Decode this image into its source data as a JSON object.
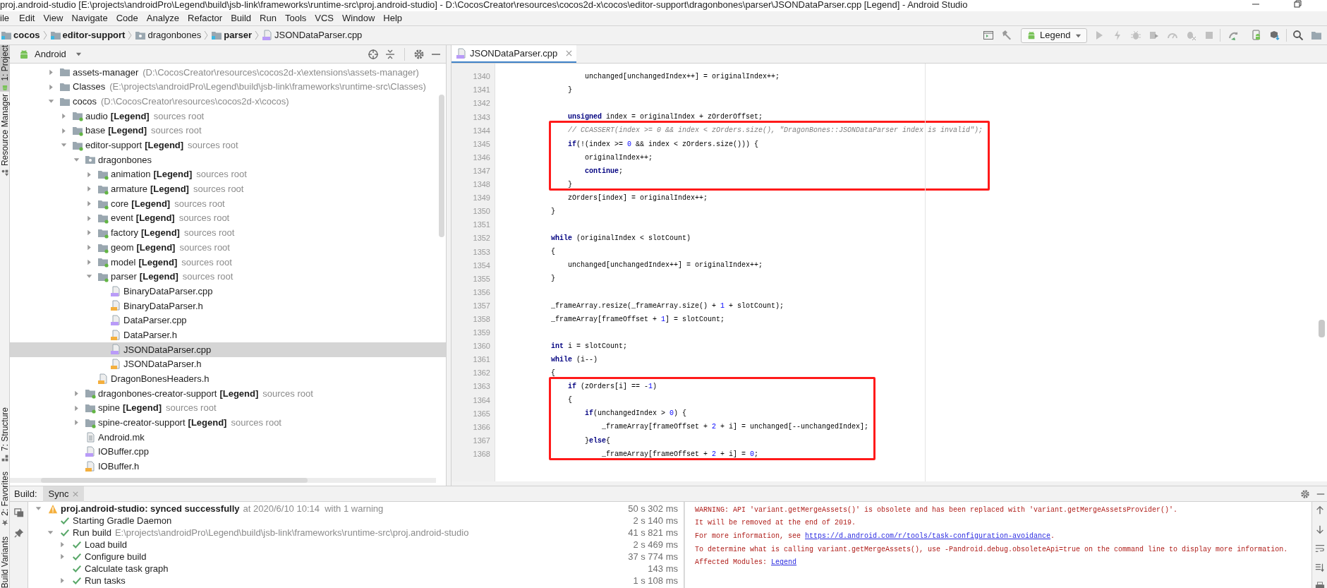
{
  "window": {
    "title": "proj.android-studio [E:\\projects\\androidPro\\Legend\\build\\jsb-link\\frameworks\\runtime-src\\proj.android-studio] - D:\\CocosCreator\\resources\\cocos2d-x\\cocos\\editor-support\\dragonbones\\parser\\JSONDataParser.cpp [Legend] - Android Studio"
  },
  "menu": [
    "ile",
    "Edit",
    "View",
    "Navigate",
    "Code",
    "Analyze",
    "Refactor",
    "Build",
    "Run",
    "Tools",
    "VCS",
    "Window",
    "Help"
  ],
  "breadcrumb": [
    {
      "label": "cocos",
      "kind": "module"
    },
    {
      "label": "editor-support",
      "kind": "module"
    },
    {
      "label": "dragonbones",
      "kind": "package"
    },
    {
      "label": "parser",
      "kind": "module"
    },
    {
      "label": "JSONDataParser.cpp",
      "kind": "cpp"
    }
  ],
  "toolbar": {
    "run_configuration": "Legend"
  },
  "tool_window_stripe": [
    {
      "label": "1: Project",
      "kind": "project",
      "selected": true
    },
    {
      "label": "Resource Manager",
      "kind": "resources",
      "selected": false
    },
    {
      "label": "7: Structure",
      "kind": "structure",
      "selected": false
    },
    {
      "label": "2: Favorites",
      "kind": "favorites",
      "selected": false
    },
    {
      "label": "Build Variants",
      "kind": "variants",
      "selected": false
    }
  ],
  "project_panel": {
    "view": "Android",
    "tree": [
      {
        "name": "assets-manager",
        "note": "(D:\\CocosCreator\\resources\\cocos2d-x\\extensions\\assets-manager)",
        "kind": "folder",
        "expanded": false,
        "selected": false
      },
      {
        "name": "Classes",
        "note": "(E:\\projects\\androidPro\\Legend\\build\\jsb-link\\frameworks\\runtime-src\\Classes)",
        "kind": "folder",
        "expanded": false,
        "selected": false
      },
      {
        "name": "cocos",
        "note": "(D:\\CocosCreator\\resources\\cocos2d-x\\cocos)",
        "kind": "folder",
        "expanded": true,
        "selected": false,
        "children": [
          {
            "name": "audio",
            "module": "[Legend]",
            "note": "sources root",
            "kind": "source",
            "expanded": false,
            "selected": false
          },
          {
            "name": "base",
            "module": "[Legend]",
            "note": "sources root",
            "kind": "source",
            "expanded": false,
            "selected": false
          },
          {
            "name": "editor-support",
            "module": "[Legend]",
            "note": "sources root",
            "kind": "source",
            "expanded": true,
            "selected": false,
            "children": [
              {
                "name": "dragonbones",
                "kind": "package",
                "expanded": true,
                "selected": false,
                "children": [
                  {
                    "name": "animation",
                    "module": "[Legend]",
                    "note": "sources root",
                    "kind": "source",
                    "expanded": false,
                    "selected": false
                  },
                  {
                    "name": "armature",
                    "module": "[Legend]",
                    "note": "sources root",
                    "kind": "source",
                    "expanded": false,
                    "selected": false
                  },
                  {
                    "name": "core",
                    "module": "[Legend]",
                    "note": "sources root",
                    "kind": "source",
                    "expanded": false,
                    "selected": false
                  },
                  {
                    "name": "event",
                    "module": "[Legend]",
                    "note": "sources root",
                    "kind": "source",
                    "expanded": false,
                    "selected": false
                  },
                  {
                    "name": "factory",
                    "module": "[Legend]",
                    "note": "sources root",
                    "kind": "source",
                    "expanded": false,
                    "selected": false
                  },
                  {
                    "name": "geom",
                    "module": "[Legend]",
                    "note": "sources root",
                    "kind": "source",
                    "expanded": false,
                    "selected": false
                  },
                  {
                    "name": "model",
                    "module": "[Legend]",
                    "note": "sources root",
                    "kind": "source",
                    "expanded": false,
                    "selected": false
                  },
                  {
                    "name": "parser",
                    "module": "[Legend]",
                    "note": "sources root",
                    "kind": "source",
                    "expanded": true,
                    "selected": false,
                    "children": [
                      {
                        "name": "BinaryDataParser.cpp",
                        "kind": "cpp",
                        "selected": false
                      },
                      {
                        "name": "BinaryDataParser.h",
                        "kind": "h",
                        "selected": false
                      },
                      {
                        "name": "DataParser.cpp",
                        "kind": "cpp",
                        "selected": false
                      },
                      {
                        "name": "DataParser.h",
                        "kind": "h",
                        "selected": false
                      },
                      {
                        "name": "JSONDataParser.cpp",
                        "kind": "cpp",
                        "selected": true
                      },
                      {
                        "name": "JSONDataParser.h",
                        "kind": "h",
                        "selected": false
                      }
                    ]
                  },
                  {
                    "name": "DragonBonesHeaders.h",
                    "kind": "h",
                    "selected": false
                  }
                ]
              },
              {
                "name": "dragonbones-creator-support",
                "module": "[Legend]",
                "note": "sources root",
                "kind": "source",
                "expanded": false,
                "selected": false
              },
              {
                "name": "spine",
                "module": "[Legend]",
                "note": "sources root",
                "kind": "source",
                "expanded": false,
                "selected": false
              },
              {
                "name": "spine-creator-support",
                "module": "[Legend]",
                "note": "sources root",
                "kind": "source",
                "expanded": false,
                "selected": false
              },
              {
                "name": "Android.mk",
                "kind": "mk",
                "selected": false
              },
              {
                "name": "IOBuffer.cpp",
                "kind": "cpp",
                "selected": false
              },
              {
                "name": "IOBuffer.h",
                "kind": "h",
                "selected": false
              }
            ]
          }
        ]
      }
    ]
  },
  "editor": {
    "tabs": [
      {
        "label": "JSONDataParser.cpp",
        "selected": true
      }
    ],
    "lines": [
      {
        "number": "1340",
        "boxed": false,
        "tokens": [
          {
            "text": "                unchanged[unchangedIndex++] = originalIndex++;",
            "kind": "plain"
          }
        ]
      },
      {
        "number": "1341",
        "boxed": false,
        "tokens": [
          {
            "text": "            }",
            "kind": "plain"
          }
        ]
      },
      {
        "number": "1342",
        "boxed": false
      },
      {
        "number": "1343",
        "boxed": false,
        "tokens": [
          {
            "text": "            unsigned",
            "kind": "keyword"
          },
          {
            "text": " index = originalIndex + zOrderOffset;",
            "kind": "plain"
          }
        ]
      },
      {
        "number": "1344",
        "boxed": true,
        "tokens": [
          {
            "text": "            // CCASSERT(index >= 0 && index < zOrders.size(), \"DragonBones::JSONDataParser index is invalid\");",
            "kind": "comment"
          }
        ]
      },
      {
        "number": "1345",
        "boxed": true,
        "tokens": [
          {
            "text": "            if",
            "kind": "keyword"
          },
          {
            "text": "(!(index >= ",
            "kind": "plain"
          },
          {
            "text": "0",
            "kind": "number"
          },
          {
            "text": " && index < zOrders.size())) {",
            "kind": "plain"
          }
        ]
      },
      {
        "number": "1346",
        "boxed": true,
        "tokens": [
          {
            "text": "                originalIndex++;",
            "kind": "plain"
          }
        ]
      },
      {
        "number": "1347",
        "boxed": true,
        "tokens": [
          {
            "text": "                continue",
            "kind": "keyword"
          },
          {
            "text": ";",
            "kind": "plain"
          }
        ]
      },
      {
        "number": "1348",
        "boxed": true,
        "tokens": [
          {
            "text": "            }",
            "kind": "plain"
          }
        ]
      },
      {
        "number": "1349",
        "boxed": false,
        "tokens": [
          {
            "text": "            zOrders[index] = originalIndex++;",
            "kind": "plain"
          }
        ]
      },
      {
        "number": "1350",
        "boxed": false,
        "tokens": [
          {
            "text": "        }",
            "kind": "plain"
          }
        ]
      },
      {
        "number": "1351",
        "boxed": false
      },
      {
        "number": "1352",
        "boxed": false,
        "tokens": [
          {
            "text": "        while",
            "kind": "keyword"
          },
          {
            "text": " (originalIndex < slotCount)",
            "kind": "plain"
          }
        ]
      },
      {
        "number": "1353",
        "boxed": false,
        "tokens": [
          {
            "text": "        {",
            "kind": "plain"
          }
        ]
      },
      {
        "number": "1354",
        "boxed": false,
        "tokens": [
          {
            "text": "            unchanged[unchangedIndex++] = originalIndex++;",
            "kind": "plain"
          }
        ]
      },
      {
        "number": "1355",
        "boxed": false,
        "tokens": [
          {
            "text": "        }",
            "kind": "plain"
          }
        ]
      },
      {
        "number": "1356",
        "boxed": false
      },
      {
        "number": "1357",
        "boxed": false,
        "tokens": [
          {
            "text": "        _frameArray.resize(_frameArray.size() + ",
            "kind": "plain"
          },
          {
            "text": "1",
            "kind": "number"
          },
          {
            "text": " + slotCount);",
            "kind": "plain"
          }
        ]
      },
      {
        "number": "1358",
        "boxed": false,
        "tokens": [
          {
            "text": "        _frameArray[frameOffset + ",
            "kind": "plain"
          },
          {
            "text": "1",
            "kind": "number"
          },
          {
            "text": "] = slotCount;",
            "kind": "plain"
          }
        ]
      },
      {
        "number": "1359",
        "boxed": false
      },
      {
        "number": "1360",
        "boxed": false,
        "tokens": [
          {
            "text": "        int",
            "kind": "keyword"
          },
          {
            "text": " i = slotCount;",
            "kind": "plain"
          }
        ]
      },
      {
        "number": "1361",
        "boxed": false,
        "tokens": [
          {
            "text": "        while",
            "kind": "keyword"
          },
          {
            "text": " (i--)",
            "kind": "plain"
          }
        ]
      },
      {
        "number": "1362",
        "boxed": false,
        "tokens": [
          {
            "text": "        {",
            "kind": "plain"
          }
        ]
      },
      {
        "number": "1363",
        "boxed": true,
        "tokens": [
          {
            "text": "            if",
            "kind": "keyword"
          },
          {
            "text": " (zOrders[i] == -",
            "kind": "plain"
          },
          {
            "text": "1",
            "kind": "number"
          },
          {
            "text": ")",
            "kind": "plain"
          }
        ]
      },
      {
        "number": "1364",
        "boxed": true,
        "tokens": [
          {
            "text": "            {",
            "kind": "plain"
          }
        ]
      },
      {
        "number": "1365",
        "boxed": true,
        "tokens": [
          {
            "text": "                if",
            "kind": "keyword"
          },
          {
            "text": "(unchangedIndex > ",
            "kind": "plain"
          },
          {
            "text": "0",
            "kind": "number"
          },
          {
            "text": ") {",
            "kind": "plain"
          }
        ]
      },
      {
        "number": "1366",
        "boxed": true,
        "tokens": [
          {
            "text": "                    _frameArray[frameOffset + ",
            "kind": "plain"
          },
          {
            "text": "2",
            "kind": "number"
          },
          {
            "text": " + i] = unchanged[--unchangedIndex];",
            "kind": "plain"
          }
        ]
      },
      {
        "number": "1367",
        "boxed": true,
        "tokens": [
          {
            "text": "                }",
            "kind": "plain"
          },
          {
            "text": "else",
            "kind": "keyword"
          },
          {
            "text": "{",
            "kind": "plain"
          }
        ]
      },
      {
        "number": "1368",
        "boxed": true,
        "tokens": [
          {
            "text": "                    _frameArray[frameOffset + ",
            "kind": "plain"
          },
          {
            "text": "2",
            "kind": "number"
          },
          {
            "text": " + i] = ",
            "kind": "plain"
          },
          {
            "text": "0",
            "kind": "number"
          },
          {
            "text": ";",
            "kind": "plain"
          }
        ]
      }
    ]
  },
  "build_panel": {
    "label": "Build:",
    "tabs": [
      {
        "label": "Sync",
        "selected": true
      }
    ],
    "tree": [
      {
        "kind": "warning",
        "label": "proj.android-studio: synced successfully",
        "detail": "at 2020/6/10 10:14  with 1 warning",
        "time": "50 s 302 ms",
        "expanded": true,
        "children": [
          {
            "kind": "success",
            "label": "Starting Gradle Daemon",
            "time": "2 s 140 ms"
          },
          {
            "kind": "success",
            "label": "Run build",
            "detail": "E:\\projects\\androidPro\\Legend\\build\\jsb-link\\frameworks\\runtime-src\\proj.android-studio",
            "time": "41 s 821 ms",
            "expanded": true,
            "children": [
              {
                "kind": "success",
                "label": "Load build",
                "time": "2 s 469 ms",
                "expanded": false
              },
              {
                "kind": "success",
                "label": "Configure build",
                "time": "37 s 774 ms",
                "expanded": false
              },
              {
                "kind": "success",
                "label": "Calculate task graph",
                "time": "143 ms"
              },
              {
                "kind": "success",
                "label": "Run tasks",
                "time": "1 s 108 ms",
                "expanded": false
              }
            ]
          }
        ]
      }
    ],
    "console": [
      [
        {
          "text": "WARNING: API 'variant.getMergeAssets()' is obsolete and has been replaced with 'variant.getMergeAssetsProvider()'.",
          "kind": "text"
        }
      ],
      [
        {
          "text": "It will be removed at the end of 2019.",
          "kind": "text"
        }
      ],
      [
        {
          "text": "For more information, see ",
          "kind": "text"
        },
        {
          "text": "https://d.android.com/r/tools/task-configuration-avoidance",
          "kind": "link"
        },
        {
          "text": ".",
          "kind": "text"
        }
      ],
      [
        {
          "text": "To determine what is calling variant.getMergeAssets(), use -Pandroid.debug.obsoleteApi=true on the command line to display more information.",
          "kind": "text"
        }
      ],
      [
        {
          "text": "Affected Modules: ",
          "kind": "text"
        },
        {
          "text": "Legend",
          "kind": "link"
        }
      ]
    ]
  }
}
